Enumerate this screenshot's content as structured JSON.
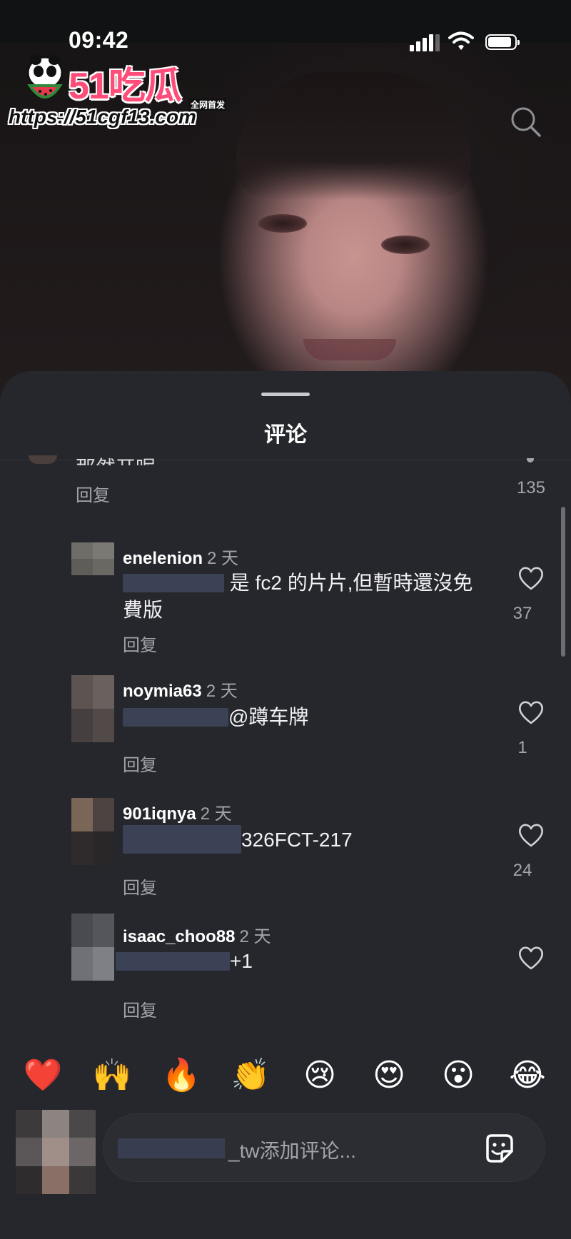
{
  "status_bar": {
    "time": "09:42"
  },
  "watermark": {
    "brand": "51吃瓜",
    "tag": "全网首发",
    "url": "https://51cgf13.com"
  },
  "comments_sheet": {
    "title": "评论",
    "partial_comment": {
      "text": "那然开呢",
      "reply_label": "回复",
      "like_count": "135"
    },
    "comments": [
      {
        "username": "enelenion",
        "time": "2 天",
        "text_lines": [
          "是 fc2 的片片,但暫時還沒免",
          "費版"
        ],
        "reply_label": "回复",
        "like_count": "37"
      },
      {
        "username": "noymia63",
        "time": "2 天",
        "text": "@蹲车牌",
        "reply_label": "回复",
        "like_count": "1"
      },
      {
        "username": "901iqnya",
        "time": "2 天",
        "text": "326FCT-217",
        "reply_label": "回复",
        "like_count": "24"
      },
      {
        "username": "isaac_choo88",
        "time": "2 天",
        "text": "+1",
        "reply_label": "回复",
        "like_count": ""
      }
    ],
    "emoji_reactions": [
      "❤️",
      "🙌",
      "🔥",
      "👏",
      "😢",
      "😍",
      "😮",
      "😂"
    ],
    "composer": {
      "placeholder_suffix": "_tw",
      "placeholder": "添加评论..."
    }
  },
  "icons": [
    "signal-icon",
    "wifi-icon",
    "battery-icon",
    "search-icon",
    "heart-icon",
    "sticker-icon"
  ],
  "colors": {
    "sheet_bg": "#25272c",
    "text_secondary": "#a3a5ab",
    "brand_pink": "#ff4d7a"
  }
}
